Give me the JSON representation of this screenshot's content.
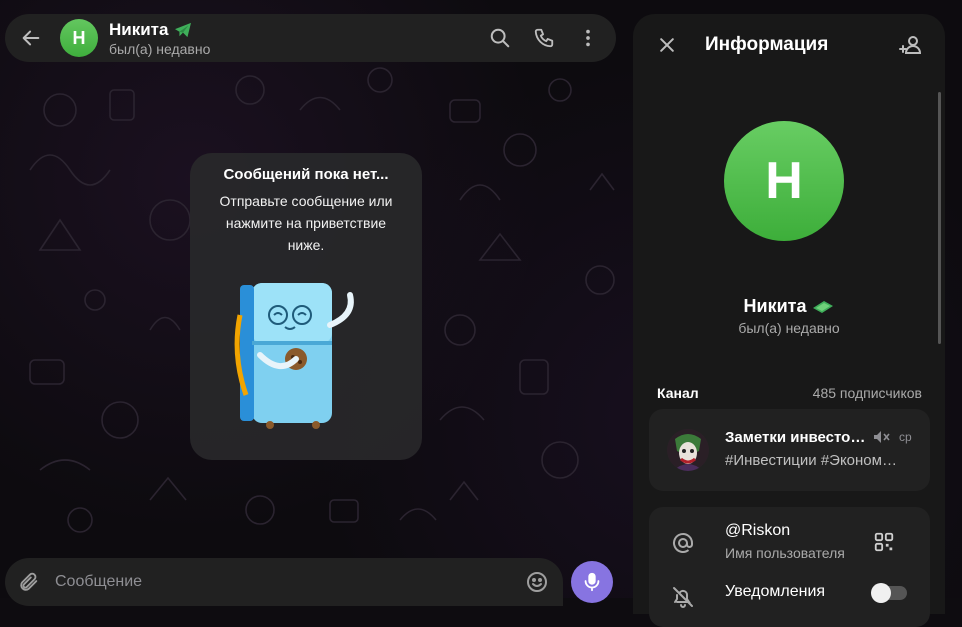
{
  "header": {
    "avatar_letter": "Н",
    "name": "Никита",
    "status": "был(а) недавно"
  },
  "empty_state": {
    "title": "Сообщений пока нет...",
    "text": "Отправьте сообщение или нажмите на приветствие ниже."
  },
  "composer": {
    "placeholder": "Сообщение"
  },
  "info": {
    "title": "Информация",
    "avatar_letter": "Н",
    "name": "Никита",
    "status": "был(а) недавно",
    "channel_label": "Канал",
    "channel_subscribers": "485 подписчиков",
    "channel": {
      "title": "Заметки инвесто…",
      "time": "ср",
      "text": "#Инвестиции #Эконом…"
    },
    "username": "@Riskon",
    "username_label": "Имя пользователя",
    "notifications_label": "Уведомления",
    "notifications_on": false
  },
  "colors": {
    "accent": "#8774e1",
    "avatar_green": "#4fbd4c",
    "premium_badge": "#3fae5a",
    "panel_bg": "#181818",
    "card_bg": "#212121"
  }
}
